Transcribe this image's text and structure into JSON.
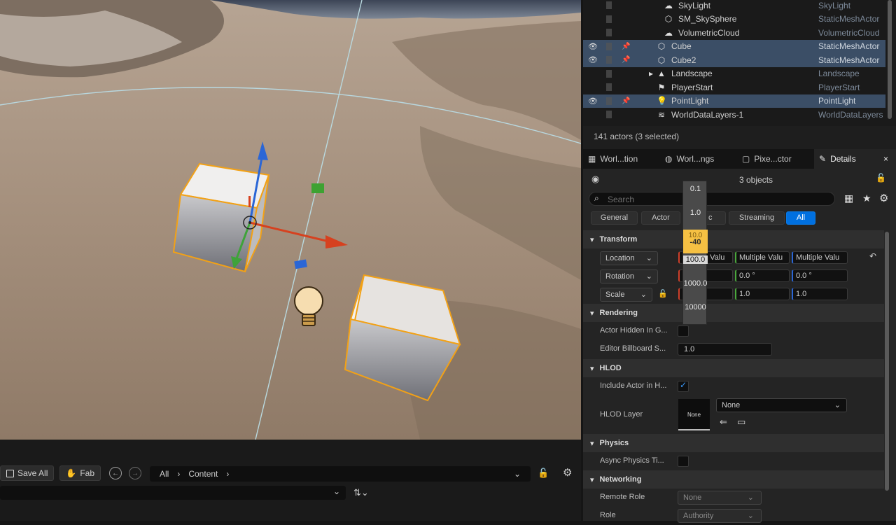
{
  "outliner": {
    "rows": [
      {
        "name": "SkyLight",
        "type": "SkyLight",
        "icon": "sky-light-icon",
        "selected": false
      },
      {
        "name": "SM_SkySphere",
        "type": "StaticMeshActor",
        "icon": "static-mesh-icon",
        "selected": false
      },
      {
        "name": "VolumetricCloud",
        "type": "VolumetricCloud",
        "icon": "cloud-icon",
        "selected": false
      },
      {
        "name": "Cube",
        "type": "StaticMeshActor",
        "icon": "static-mesh-icon",
        "selected": true
      },
      {
        "name": "Cube2",
        "type": "StaticMeshActor",
        "icon": "static-mesh-icon",
        "selected": true
      },
      {
        "name": "Landscape",
        "type": "Landscape",
        "icon": "landscape-icon",
        "selected": false
      },
      {
        "name": "PlayerStart",
        "type": "PlayerStart",
        "icon": "player-start-icon",
        "selected": false
      },
      {
        "name": "PointLight",
        "type": "PointLight",
        "icon": "bulb-icon",
        "selected": true
      },
      {
        "name": "WorldDataLayers-1",
        "type": "WorldDataLayers",
        "icon": "layers-icon",
        "selected": false
      }
    ],
    "status": "141 actors (3 selected)"
  },
  "tabs": [
    {
      "label": "Worl...tion",
      "icon": "world-partition-icon"
    },
    {
      "label": "Worl...ngs",
      "icon": "globe-icon"
    },
    {
      "label": "Pixe...ctor",
      "icon": "pixel-icon"
    },
    {
      "label": "Details",
      "icon": "pencil-icon",
      "close": "×"
    }
  ],
  "details": {
    "objects": "3 objects",
    "search_placeholder": "Search",
    "filters": [
      "General",
      "Actor",
      "c",
      "Streaming",
      "All"
    ],
    "transform": {
      "title": "Transform",
      "location_label": "Location",
      "location_values": [
        "e Valu",
        "Multiple Valu",
        "Multiple Valu"
      ],
      "rotation_label": "Rotation",
      "rotation_values": [
        "0.0 °",
        "0.0 °"
      ],
      "scale_label": "Scale",
      "scale_values": [
        "1.0",
        "1.0"
      ]
    },
    "rendering": {
      "title": "Rendering",
      "hidden_label": "Actor Hidden In G...",
      "billboard_label": "Editor Billboard S...",
      "billboard_value": "1.0"
    },
    "hlod": {
      "title": "HLOD",
      "include_label": "Include Actor in H...",
      "layer_label": "HLOD Layer",
      "thumb_text": "None",
      "layer_value": "None"
    },
    "physics": {
      "title": "Physics",
      "async_label": "Async Physics Ti..."
    },
    "networking": {
      "title": "Networking",
      "remote_role_label": "Remote Role",
      "remote_role_value": "None",
      "role_label": "Role",
      "role_value": "Authority"
    }
  },
  "snap_popup": {
    "values": [
      "0.1",
      "1.0",
      "10.0",
      "-40",
      "100.0",
      "1000.0",
      "10000"
    ]
  },
  "content_browser": {
    "save_all": "Save All",
    "fab": "Fab",
    "path": [
      "All",
      "Content"
    ]
  }
}
